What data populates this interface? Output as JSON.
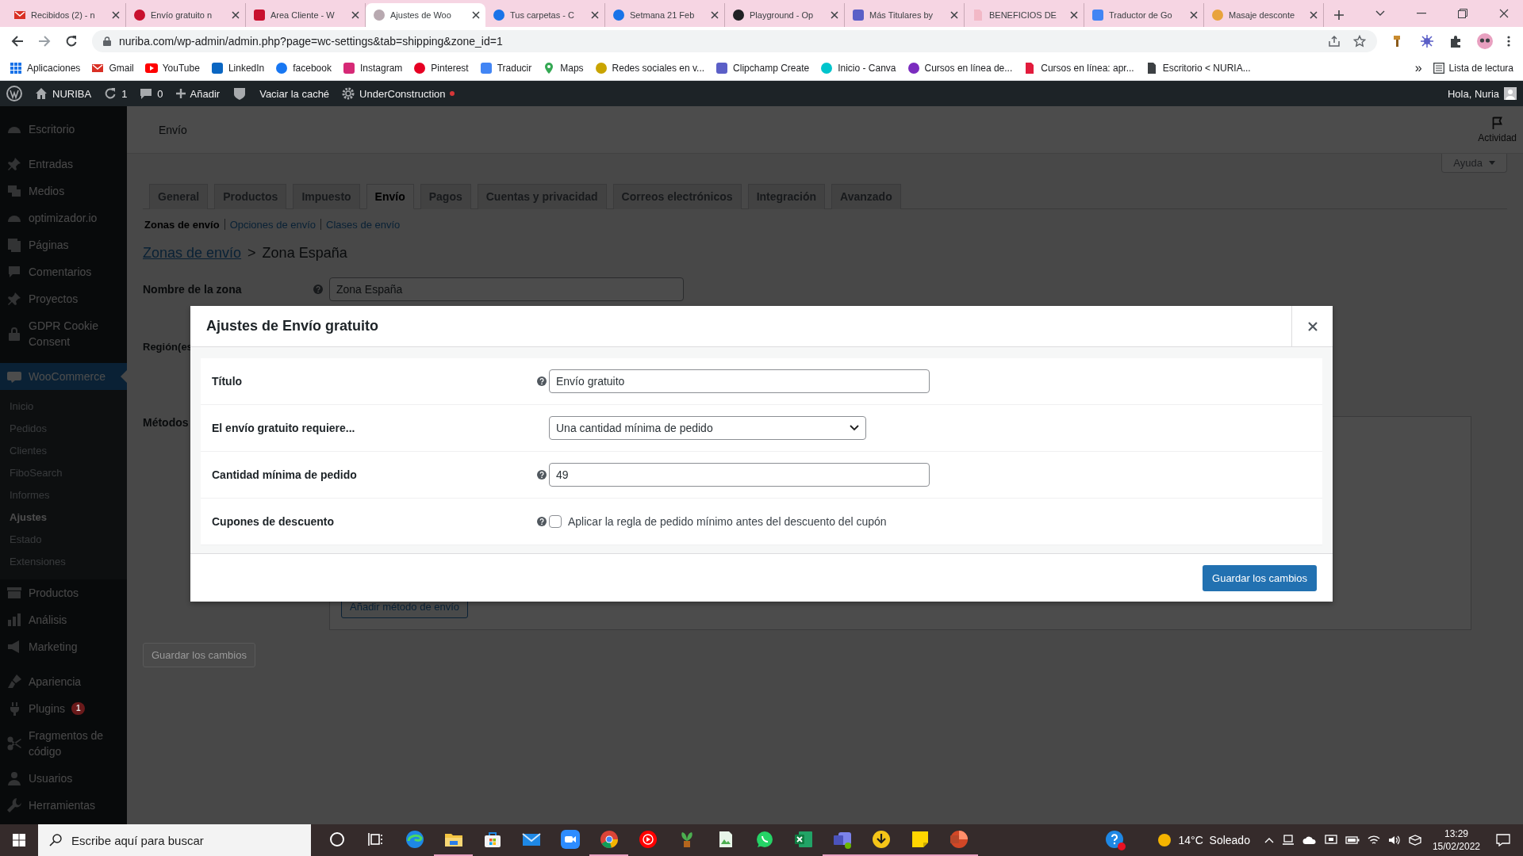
{
  "browser": {
    "tabs": [
      {
        "title": "Recibidos (2) - n",
        "kind": "envelope",
        "color": "#d93025",
        "selected": false
      },
      {
        "title": "Envío gratuito n",
        "kind": "disc",
        "color": "#c8102e",
        "selected": false
      },
      {
        "title": "Area Cliente - W",
        "kind": "square",
        "color": "#c8102e",
        "selected": false
      },
      {
        "title": "Ajustes de Woo",
        "kind": "disc",
        "color": "#b8a9b0",
        "selected": true
      },
      {
        "title": "Tus carpetas - C",
        "kind": "disc",
        "color": "#1a73e8",
        "selected": false
      },
      {
        "title": "Setmana 21 Feb",
        "kind": "disc",
        "color": "#1a73e8",
        "selected": false
      },
      {
        "title": "Playground - Op",
        "kind": "disc",
        "color": "#202124",
        "selected": false
      },
      {
        "title": "Más Titulares by",
        "kind": "square",
        "color": "#5b5fc7",
        "selected": false
      },
      {
        "title": "BENEFICIOS DE",
        "kind": "page",
        "color": "#f2b8c6",
        "selected": false
      },
      {
        "title": "Traductor de Go",
        "kind": "square",
        "color": "#4285f4",
        "selected": false
      },
      {
        "title": "Masaje desconte",
        "kind": "disc",
        "color": "#e8a33d",
        "selected": false
      }
    ],
    "address": "nuriba.com/wp-admin/admin.php?page=wc-settings&tab=shipping&zone_id=1",
    "bookmarks": [
      {
        "label": "Aplicaciones",
        "kind": "grid",
        "color": "#1a73e8"
      },
      {
        "label": "Gmail",
        "kind": "envelope",
        "color": "#d93025"
      },
      {
        "label": "YouTube",
        "kind": "play",
        "color": "#ff0000"
      },
      {
        "label": "LinkedIn",
        "kind": "square",
        "color": "#0a66c2"
      },
      {
        "label": "facebook",
        "kind": "disc",
        "color": "#1877f2"
      },
      {
        "label": "Instagram",
        "kind": "square",
        "color": "#d62976"
      },
      {
        "label": "Pinterest",
        "kind": "disc",
        "color": "#e60023"
      },
      {
        "label": "Traducir",
        "kind": "square",
        "color": "#4285f4"
      },
      {
        "label": "Maps",
        "kind": "pin",
        "color": "#34a853"
      },
      {
        "label": "Redes sociales en v...",
        "kind": "disc",
        "color": "#c9a400"
      },
      {
        "label": "Clipchamp Create",
        "kind": "square",
        "color": "#5b5fc7"
      },
      {
        "label": "Inicio - Canva",
        "kind": "disc",
        "color": "#00c4cc"
      },
      {
        "label": "Cursos en línea de...",
        "kind": "disc",
        "color": "#7b2cbf"
      },
      {
        "label": "Cursos en línea: apr...",
        "kind": "page",
        "color": "#e21b3c"
      },
      {
        "label": "Escritorio < NURIA...",
        "kind": "page",
        "color": "#3c4043"
      }
    ],
    "more": "»",
    "reading_list": "Lista de lectura"
  },
  "admin_bar": {
    "site": "NURIBA",
    "updates": "1",
    "comments": "0",
    "add": "Añadir",
    "cache": "Vaciar la caché",
    "plugin": "UnderConstruction",
    "greeting": "Hola, Nuria"
  },
  "sidebar": {
    "groups": [
      [
        {
          "label": "Escritorio",
          "kind": "gauge"
        }
      ],
      [
        {
          "label": "Entradas",
          "kind": "pushpin"
        },
        {
          "label": "Medios",
          "kind": "media"
        },
        {
          "label": "optimizador.io",
          "kind": "gauge"
        },
        {
          "label": "Páginas",
          "kind": "pages"
        },
        {
          "label": "Comentarios",
          "kind": "bubble"
        },
        {
          "label": "Proyectos",
          "kind": "pushpin"
        },
        {
          "label": "GDPR Cookie Consent",
          "kind": "lock"
        }
      ],
      [
        {
          "label": "WooCommerce",
          "kind": "store",
          "selected": true,
          "children": [
            {
              "label": "Inicio",
              "selected": false
            },
            {
              "label": "Pedidos",
              "selected": false
            },
            {
              "label": "Clientes",
              "selected": false
            },
            {
              "label": "FiboSearch",
              "selected": false
            },
            {
              "label": "Informes",
              "selected": false
            },
            {
              "label": "Ajustes",
              "selected": true
            },
            {
              "label": "Estado",
              "selected": false
            },
            {
              "label": "Extensiones",
              "selected": false
            }
          ]
        },
        {
          "label": "Productos",
          "kind": "archive",
          "selected": false
        },
        {
          "label": "Análisis",
          "kind": "chart",
          "selected": false
        },
        {
          "label": "Marketing",
          "kind": "megaphone",
          "selected": false
        }
      ],
      [
        {
          "label": "Apariencia",
          "kind": "brush"
        },
        {
          "label": "Plugins",
          "kind": "plug",
          "badge": "1"
        },
        {
          "label": "Fragmentos de código",
          "kind": "scissors"
        },
        {
          "label": "Usuarios",
          "kind": "user"
        },
        {
          "label": "Herramientas",
          "kind": "wrench"
        }
      ]
    ]
  },
  "page": {
    "title": "Envío",
    "activity": "Actividad",
    "help": "Ayuda",
    "tabs": [
      {
        "label": "General",
        "selected": false
      },
      {
        "label": "Productos",
        "selected": false
      },
      {
        "label": "Impuesto",
        "selected": false
      },
      {
        "label": "Envío",
        "selected": true
      },
      {
        "label": "Pagos",
        "selected": false
      },
      {
        "label": "Cuentas y privacidad",
        "selected": false
      },
      {
        "label": "Correos electrónicos",
        "selected": false
      },
      {
        "label": "Integración",
        "selected": false
      },
      {
        "label": "Avanzado",
        "selected": false
      }
    ],
    "sublinks": [
      {
        "label": "Zonas de envío",
        "selected": true
      },
      {
        "label": "Opciones de envío",
        "selected": false
      },
      {
        "label": "Clases de envío",
        "selected": false
      }
    ],
    "breadcrumb": {
      "link": "Zonas de envío",
      "separator": ">",
      "current": "Zona España"
    },
    "zone_name_label": "Nombre de la zona",
    "zone_name_value": "Zona España",
    "region_label": "Región(es",
    "methods_label": "Métodos",
    "add_method": "Añadir método de envío",
    "save": "Guardar los cambios"
  },
  "modal": {
    "title": "Ajustes de Envío gratuito",
    "fields": [
      {
        "label": "Título",
        "kind": "text",
        "value": "Envío gratuito",
        "help": true
      },
      {
        "label": "El envío gratuito requiere...",
        "kind": "select",
        "value": "Una cantidad mínima de pedido",
        "help": false
      },
      {
        "label": "Cantidad mínima de pedido",
        "kind": "text",
        "value": "49",
        "help": true
      },
      {
        "label": "Cupones de descuento",
        "kind": "checkbox",
        "text": "Aplicar la regla de pedido mínimo antes del descuento del cupón",
        "checked": false,
        "help": true
      }
    ],
    "save": "Guardar los cambios"
  },
  "taskbar": {
    "search_placeholder": "Escribe aquí para buscar",
    "apps": [
      {
        "kind": "ring",
        "running": false
      },
      {
        "kind": "taskview",
        "running": false
      },
      {
        "kind": "swirl",
        "running": false
      },
      {
        "kind": "folder",
        "running": true
      },
      {
        "kind": "bag",
        "running": false
      },
      {
        "kind": "mail",
        "running": false
      },
      {
        "kind": "camera",
        "running": false
      },
      {
        "kind": "tricolor",
        "running": true
      },
      {
        "kind": "play",
        "running": false
      },
      {
        "kind": "plant",
        "running": false
      },
      {
        "kind": "document",
        "running": false
      },
      {
        "kind": "chat",
        "running": false
      },
      {
        "kind": "sheet",
        "running": false
      },
      {
        "kind": "people",
        "running": true
      },
      {
        "kind": "download",
        "running": true
      },
      {
        "kind": "note",
        "running": true
      },
      {
        "kind": "slides",
        "running": true
      }
    ],
    "weather": "14°C  Soleado",
    "time": "13:29",
    "date": "15/02/2022"
  }
}
